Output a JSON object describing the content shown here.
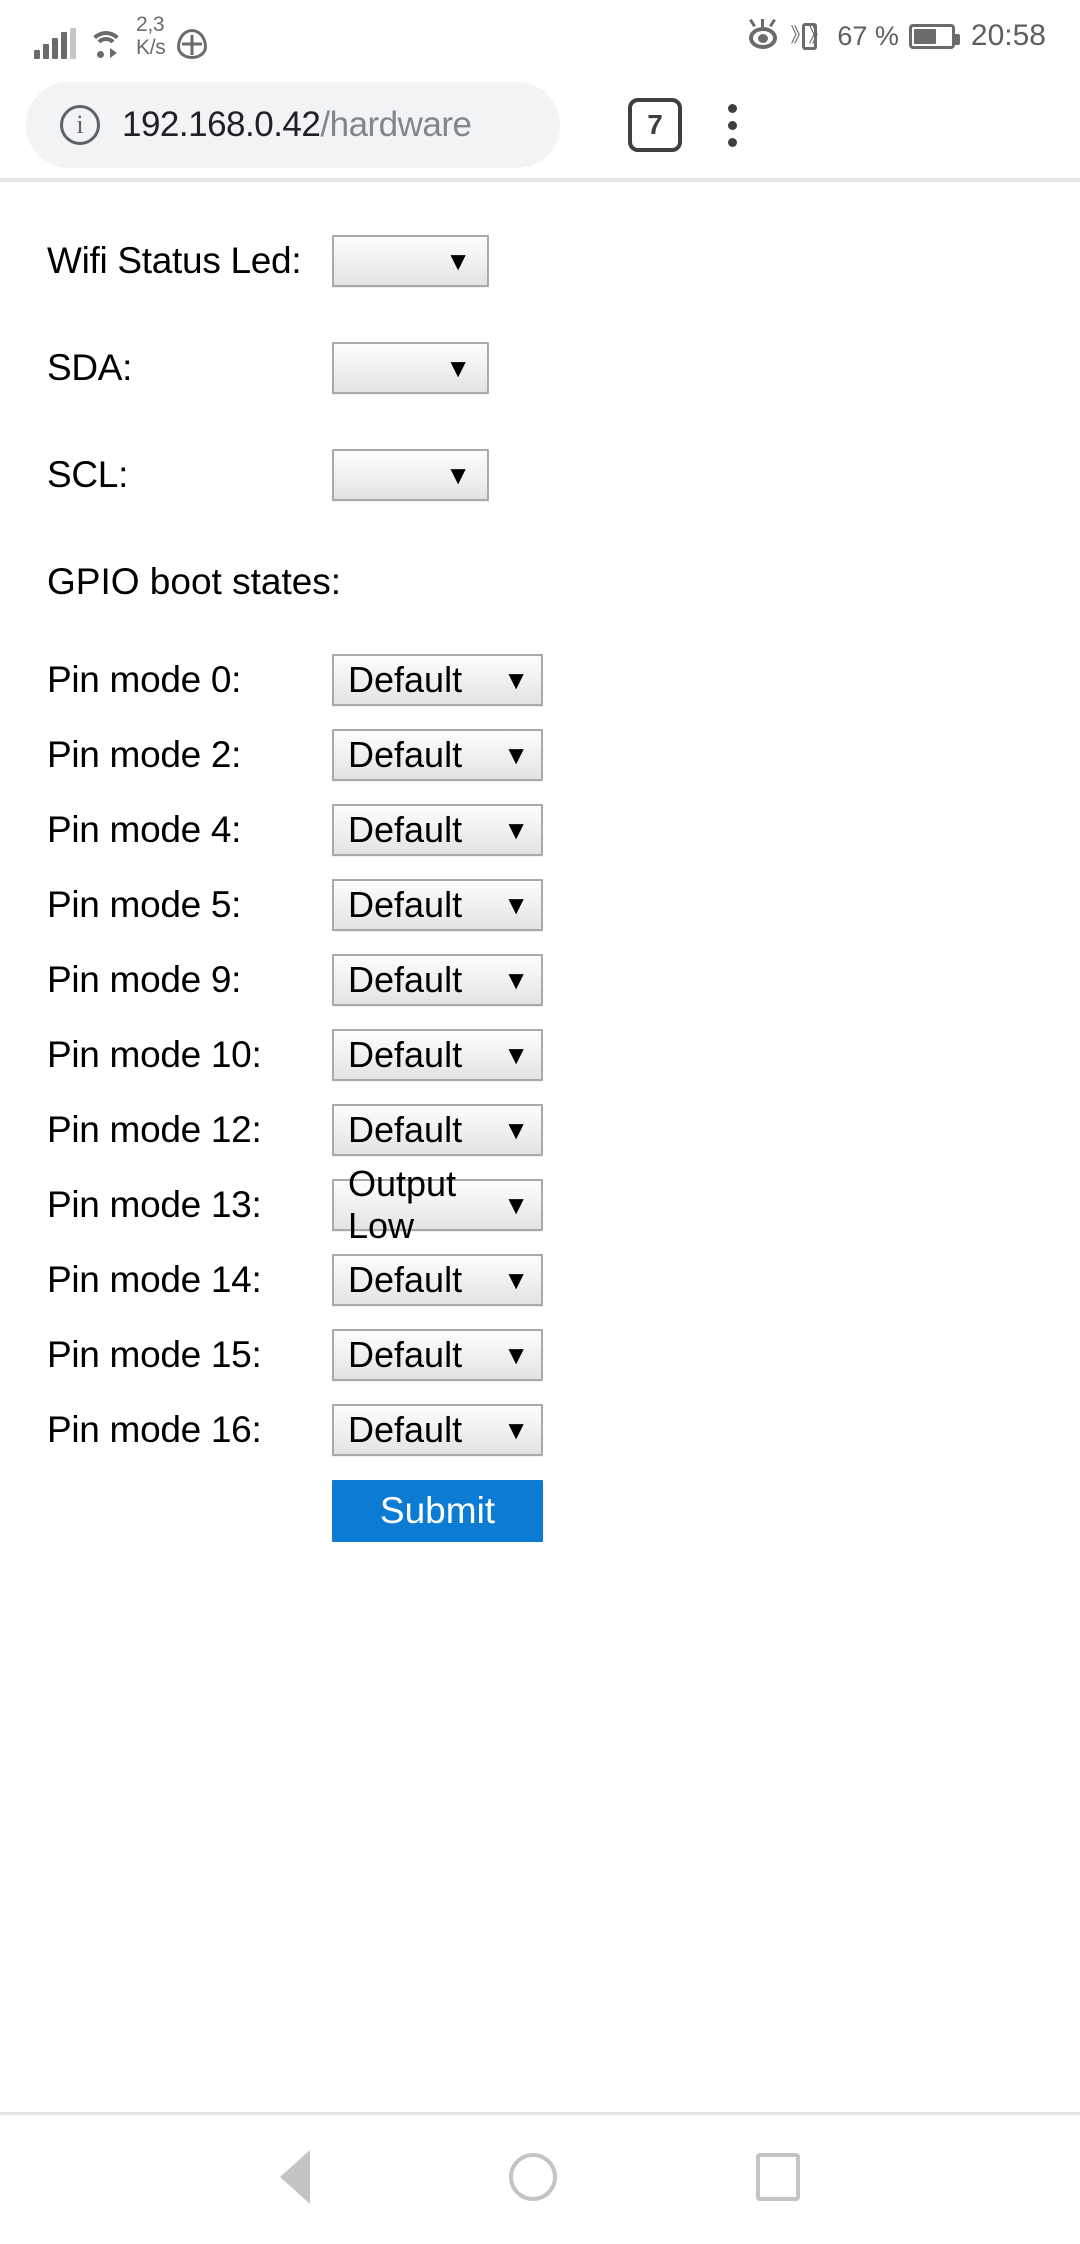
{
  "status_bar": {
    "network_speed": "2,3\nK/s",
    "network_speed_value": "2,3",
    "network_speed_unit": "K/s",
    "battery_percent": "67 %",
    "clock": "20:58",
    "icons": [
      "signal-bars-icon",
      "wifi-icon",
      "location-icon",
      "eye-comfort-icon",
      "vibrate-icon",
      "battery-icon"
    ]
  },
  "browser": {
    "url_host": "192.168.0.42",
    "url_path": "/hardware",
    "tab_count": "7",
    "security_icon": "info-icon",
    "menu_icon": "kebab-menu-icon"
  },
  "page": {
    "top_fields": [
      {
        "label": "Wifi Status Led:",
        "value": ""
      },
      {
        "label": "SDA:",
        "value": ""
      },
      {
        "label": "SCL:",
        "value": ""
      }
    ],
    "section_heading": "GPIO boot states:",
    "pin_modes": [
      {
        "label": "Pin mode 0:",
        "value": "Default"
      },
      {
        "label": "Pin mode 2:",
        "value": "Default"
      },
      {
        "label": "Pin mode 4:",
        "value": "Default"
      },
      {
        "label": "Pin mode 5:",
        "value": "Default"
      },
      {
        "label": "Pin mode 9:",
        "value": "Default"
      },
      {
        "label": "Pin mode 10:",
        "value": "Default"
      },
      {
        "label": "Pin mode 12:",
        "value": "Default"
      },
      {
        "label": "Pin mode 13:",
        "value": "Output Low"
      },
      {
        "label": "Pin mode 14:",
        "value": "Default"
      },
      {
        "label": "Pin mode 15:",
        "value": "Default"
      },
      {
        "label": "Pin mode 16:",
        "value": "Default"
      }
    ],
    "submit_label": "Submit",
    "accent_color": "#0b7bd4",
    "dropdown_caret": "▼"
  },
  "navigation_bar": {
    "back_icon": "back-triangle-icon",
    "home_icon": "home-circle-icon",
    "recents_icon": "recent-apps-square-icon"
  }
}
